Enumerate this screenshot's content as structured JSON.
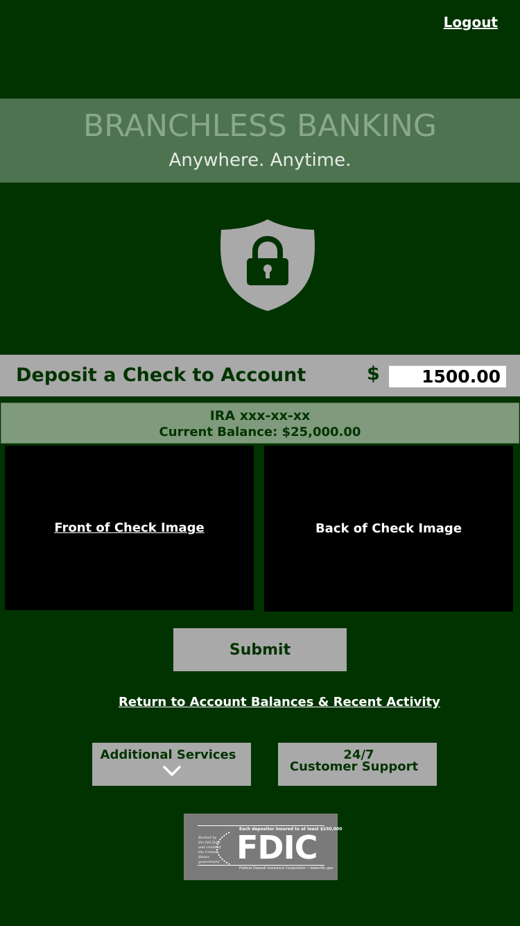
{
  "header": {
    "logout_label": "Logout"
  },
  "hero": {
    "title": "BRANCHLESS BANKING",
    "subtitle": "Anywhere.  Anytime."
  },
  "deposit": {
    "title": "Deposit a Check to Account",
    "currency_symbol": "$",
    "amount_value": "1500.00"
  },
  "account": {
    "name": "IRA xxx-xx-xx",
    "balance_text": "Current Balance: $25,000.00"
  },
  "check_images": {
    "front_label": "Front of Check Image",
    "back_label": "Back of Check Image"
  },
  "actions": {
    "submit_label": "Submit",
    "return_label": "Return to Account Balances & Recent Activity"
  },
  "services": {
    "additional_label": "Additional Services",
    "support_line1": "24/7",
    "support_line2": "Customer Support"
  },
  "fdic": {
    "top_text": "Each depositor insured to at least $250,000",
    "side_text": "Backed by the full faith and credit of the United States government",
    "word": "FDIC",
    "bottom_text": "Federal Deposit Insurance Corporation • www.fdic.gov"
  },
  "colors": {
    "background": "#013300",
    "hero_band": "#4e7350",
    "gray_panel": "#a9a9a9",
    "account_panel": "#7f9a7c"
  },
  "icons": {
    "security": "shield-lock-icon",
    "expand": "chevron-down-icon"
  }
}
